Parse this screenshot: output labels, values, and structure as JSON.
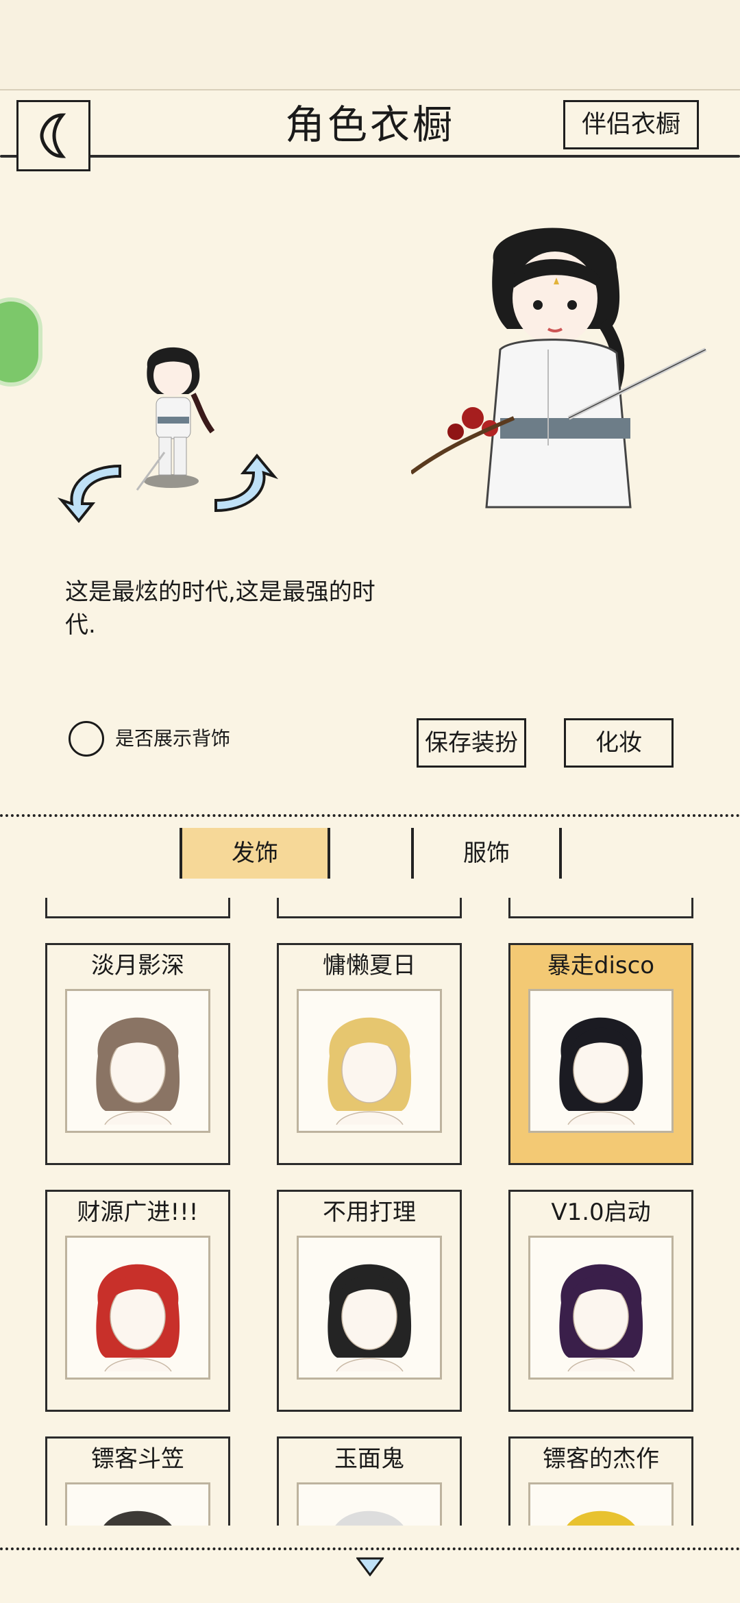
{
  "header": {
    "title": "角色衣橱",
    "partner_button": "伴侣衣橱"
  },
  "character": {
    "description": "这是最炫的时代,这是最强的时代."
  },
  "options": {
    "show_back_accessory_label": "是否展示背饰"
  },
  "actions": {
    "save_label": "保存装扮",
    "makeup_label": "化妆"
  },
  "tabs": [
    {
      "label": "发饰",
      "active": true
    },
    {
      "label": "服饰",
      "active": false
    }
  ],
  "items": [
    {
      "name": "淡月影深",
      "hair": "#8a7464",
      "selected": false
    },
    {
      "name": "慵懒夏日",
      "hair": "#e6c66f",
      "selected": false
    },
    {
      "name": "暴走disco",
      "hair": "#1b1b22",
      "selected": true
    },
    {
      "name": "财源广进!!!",
      "hair": "#c8302a",
      "selected": false
    },
    {
      "name": "不用打理",
      "hair": "#242424",
      "selected": false
    },
    {
      "name": "V1.0启动",
      "hair": "#3a1f4a",
      "selected": false
    },
    {
      "name": "镖客斗笠",
      "hair": "#3d3a36",
      "selected": false
    },
    {
      "name": "玉面鬼",
      "hair": "#dddddd",
      "selected": false
    },
    {
      "name": "镖客的杰作",
      "hair": "#e8c230",
      "selected": false
    }
  ],
  "colors": {
    "background": "#faf4e4",
    "selected_card": "#f3c974",
    "active_tab": "#f6d898"
  }
}
